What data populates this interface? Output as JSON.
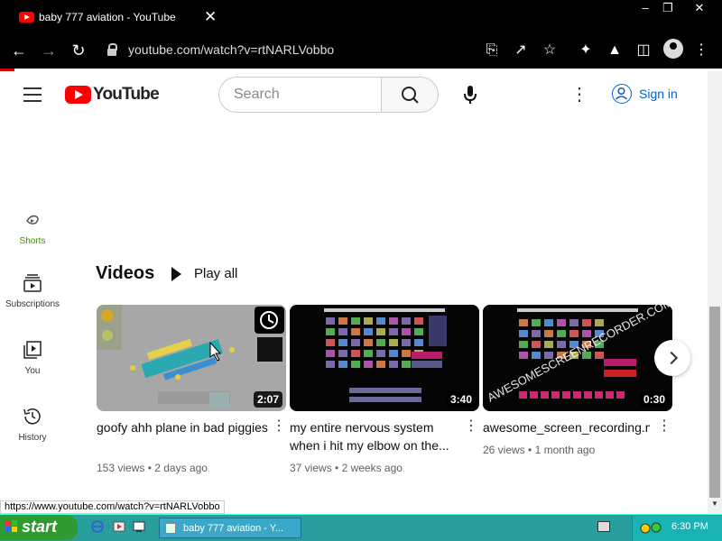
{
  "browser": {
    "tab_title": "baby 777 aviation - YouTube",
    "tab_close": "✕",
    "url": "youtube.com/watch?v=rtNARLVobbo",
    "window_controls": [
      "–",
      "❐",
      "✕"
    ]
  },
  "youtube": {
    "logo_text": "YouTube",
    "search_placeholder": "Search",
    "more_icon": "⋮",
    "signin_label": "Sign in"
  },
  "sidebar": {
    "items": [
      {
        "label": "Shorts",
        "icon": "shorts-icon",
        "active": true
      },
      {
        "label": "Subscriptions",
        "icon": "subscriptions-icon"
      },
      {
        "label": "You",
        "icon": "you-icon"
      },
      {
        "label": "History",
        "icon": "history-icon"
      }
    ]
  },
  "section": {
    "title": "Videos",
    "play_all": "Play all"
  },
  "videos": [
    {
      "title": "goofy ahh plane in bad piggies",
      "duration": "2:07",
      "views": "153 views",
      "age": "2 days ago"
    },
    {
      "title": "my entire nervous system when i hit my elbow on the...",
      "duration": "3:40",
      "views": "37 views",
      "age": "2 weeks ago"
    },
    {
      "title": "awesome_screen_recording.m",
      "duration": "0:30",
      "views": "26 views",
      "age": "1 month ago"
    }
  ],
  "meta_separator": " • ",
  "status_url": "https://www.youtube.com/watch?v=rtNARLVobbo",
  "taskbar": {
    "start_label": "start",
    "window_label": "baby 777 aviation - Y...",
    "clock": "6:30 PM"
  },
  "colors": {
    "yt_red": "#ff0000",
    "link_blue": "#065fd4",
    "taskbar": "#2a9d9d",
    "start_green": "#2f9a2f"
  }
}
